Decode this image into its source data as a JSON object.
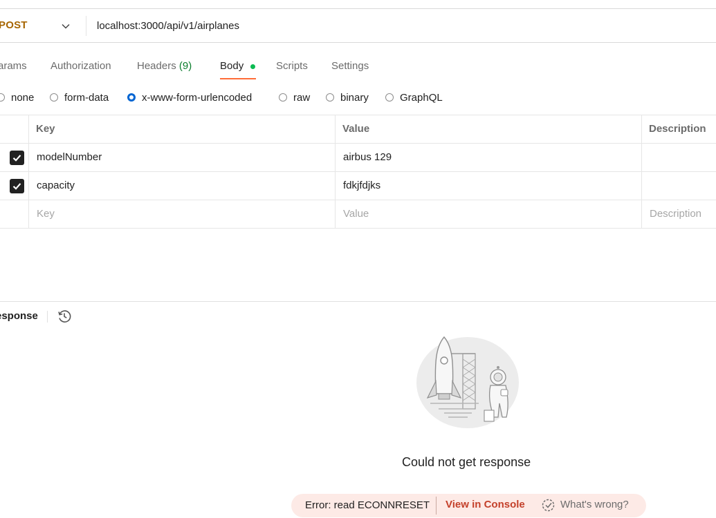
{
  "request": {
    "method": "POST",
    "url": "localhost:3000/api/v1/airplanes"
  },
  "tabs": [
    {
      "label": "arams"
    },
    {
      "label": "Authorization"
    },
    {
      "label": "Headers",
      "count": "(9)"
    },
    {
      "label": "Body",
      "active": true
    },
    {
      "label": "Scripts"
    },
    {
      "label": "Settings"
    }
  ],
  "body_types": [
    {
      "label": "none"
    },
    {
      "label": "form-data"
    },
    {
      "label": "x-www-form-urlencoded",
      "selected": true
    },
    {
      "label": "raw"
    },
    {
      "label": "binary"
    },
    {
      "label": "GraphQL"
    }
  ],
  "table": {
    "headers": {
      "key": "Key",
      "value": "Value",
      "description": "Description"
    },
    "rows": [
      {
        "checked": true,
        "key": "modelNumber",
        "value": "airbus 129",
        "description": ""
      },
      {
        "checked": true,
        "key": "capacity",
        "value": "fdkjfdjks",
        "description": ""
      }
    ],
    "placeholder": {
      "key": "Key",
      "value": "Value",
      "description": "Description"
    }
  },
  "response": {
    "title": "esponse",
    "empty_message": "Could not get response",
    "error_text": "Error: read ECONNRESET",
    "console_link": "View in Console",
    "whats_wrong": "What's wrong?"
  },
  "colors": {
    "method": "#a66500",
    "accent": "#ff6c37",
    "radio_selected": "#0265d2",
    "body_dot": "#0cbb52",
    "error_bg": "#fdeae6",
    "error_link": "#c4402a"
  },
  "icons": {
    "method_dropdown": "chevron-down-icon",
    "history": "history-icon",
    "whats_wrong": "troubleshoot-icon",
    "checkbox": "checkmark-icon"
  }
}
